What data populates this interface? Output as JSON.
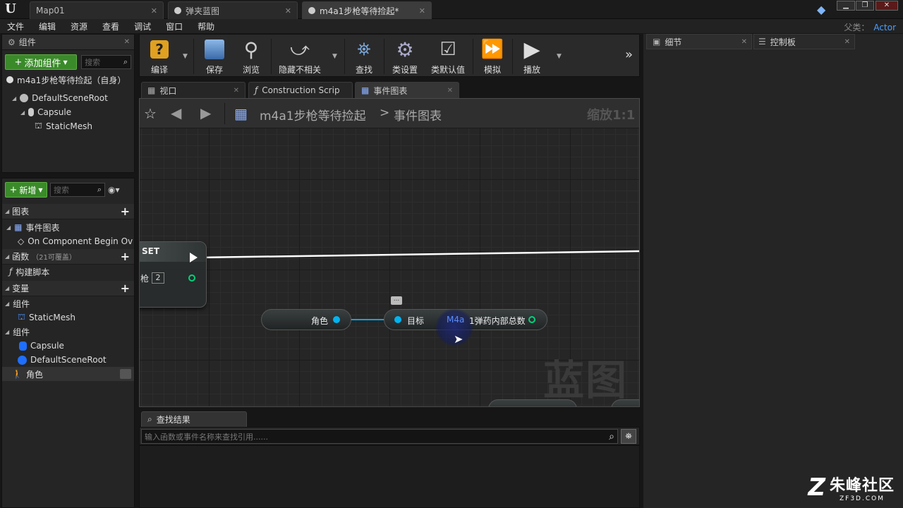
{
  "titlebar": {
    "tabs": [
      {
        "label": "Map01"
      },
      {
        "label": "弹夹蓝图"
      },
      {
        "label": "m4a1步枪等待捡起*"
      }
    ],
    "window_buttons": {
      "minimize": "▁",
      "restore": "❐",
      "close": "✕"
    }
  },
  "menu": {
    "items": [
      "文件",
      "编辑",
      "资源",
      "查看",
      "调试",
      "窗口",
      "帮助"
    ],
    "parent_label": "父类：",
    "parent_value": "Actor"
  },
  "components": {
    "title": "组件",
    "add_button": "添加组件",
    "search_placeholder": "搜索",
    "root_label": "m4a1步枪等待捡起（自身）",
    "tree": [
      "DefaultSceneRoot",
      "Capsule",
      "StaticMesh"
    ]
  },
  "mybp": {
    "new_button": "新增",
    "search_placeholder": "搜索",
    "graphs_header": "图表",
    "event_graph": "事件图表",
    "event_item": "On Component Begin Ov",
    "functions_header": "函数",
    "functions_note": "（21可覆盖）",
    "construct_item": "构建脚本",
    "variables_header": "变量",
    "group1_label": "组件",
    "group1_items": [
      "StaticMesh"
    ],
    "group2_label": "组件",
    "group2_items": [
      "Capsule",
      "DefaultSceneRoot",
      "角色"
    ]
  },
  "toolbar": {
    "compile": "编译",
    "save": "保存",
    "browse": "浏览",
    "hide_unrelated": "隐藏不相关",
    "find": "查找",
    "class_settings": "类设置",
    "class_defaults": "类默认值",
    "simulate": "模拟",
    "play": "播放"
  },
  "editor_tabs": [
    "视口",
    "Construction Scrip",
    "事件图表"
  ],
  "graph": {
    "breadcrumb_bp": "m4a1步枪等待捡起",
    "breadcrumb_sep": ">",
    "breadcrumb_graph": "事件图表",
    "zoom": "缩放1:1",
    "watermark": "蓝图",
    "set_node": {
      "title": "SET",
      "pin_label": "枪",
      "pin_value": "2"
    },
    "char_node": {
      "label": "角色"
    },
    "target_node": {
      "target_label": "目标",
      "prefix": "M4a",
      "output_label": "1弹药内部总数"
    },
    "comment_icon": "..."
  },
  "find_results": {
    "tab_label": "查找结果",
    "placeholder": "输入函数或事件名称来查找引用......"
  },
  "right": {
    "details_tab": "细节",
    "dashboard_tab": "控制板"
  },
  "site_watermark": {
    "name": "朱峰社区",
    "url": "ZF3D.COM"
  },
  "colors": {
    "accent_blue": "#4aa0ff",
    "green_button": "#3a8a2a",
    "pin_cyan": "#00b4f0",
    "pin_green": "#00d37a"
  }
}
